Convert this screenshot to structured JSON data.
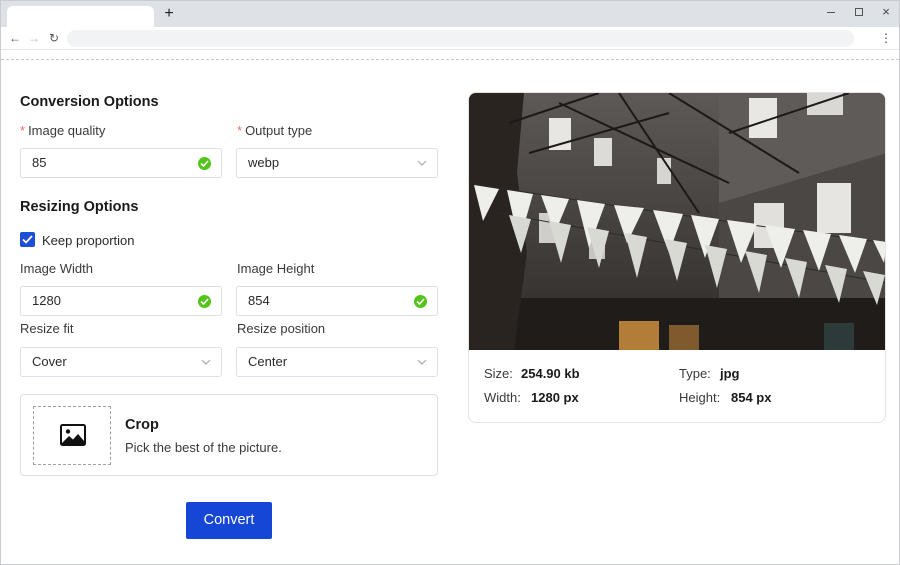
{
  "browser": {
    "new_tab_label": "+",
    "window_controls": {
      "minimize": "minimize-icon",
      "maximize": "maximize-icon",
      "close": "×"
    },
    "nav": {
      "back": "←",
      "forward": "→",
      "reload": "↻",
      "menu": "⋮"
    }
  },
  "conversion": {
    "title": "Conversion Options",
    "quality_label": "Image quality",
    "quality_value": "85",
    "output_label": "Output type",
    "output_value": "webp"
  },
  "resizing": {
    "title": "Resizing Options",
    "keep_proportion_label": "Keep proportion",
    "keep_proportion_checked": true,
    "width_label": "Image Width",
    "width_value": "1280",
    "height_label": "Image Height",
    "height_value": "854",
    "fit_label": "Resize fit",
    "fit_value": "Cover",
    "position_label": "Resize position",
    "position_value": "Center"
  },
  "crop": {
    "title": "Crop",
    "description": "Pick the best of the picture.",
    "icon": "image-icon"
  },
  "convert_button": "Convert",
  "preview": {
    "size_key": "Size:",
    "size_value": "254.90 kb",
    "type_key": "Type:",
    "type_value": "jpg",
    "width_key": "Width:",
    "width_value": "1280 px",
    "height_key": "Height:",
    "height_value": "854 px"
  },
  "colors": {
    "accent": "#1546d6",
    "success": "#52c41a",
    "required": "#f26b6b"
  }
}
